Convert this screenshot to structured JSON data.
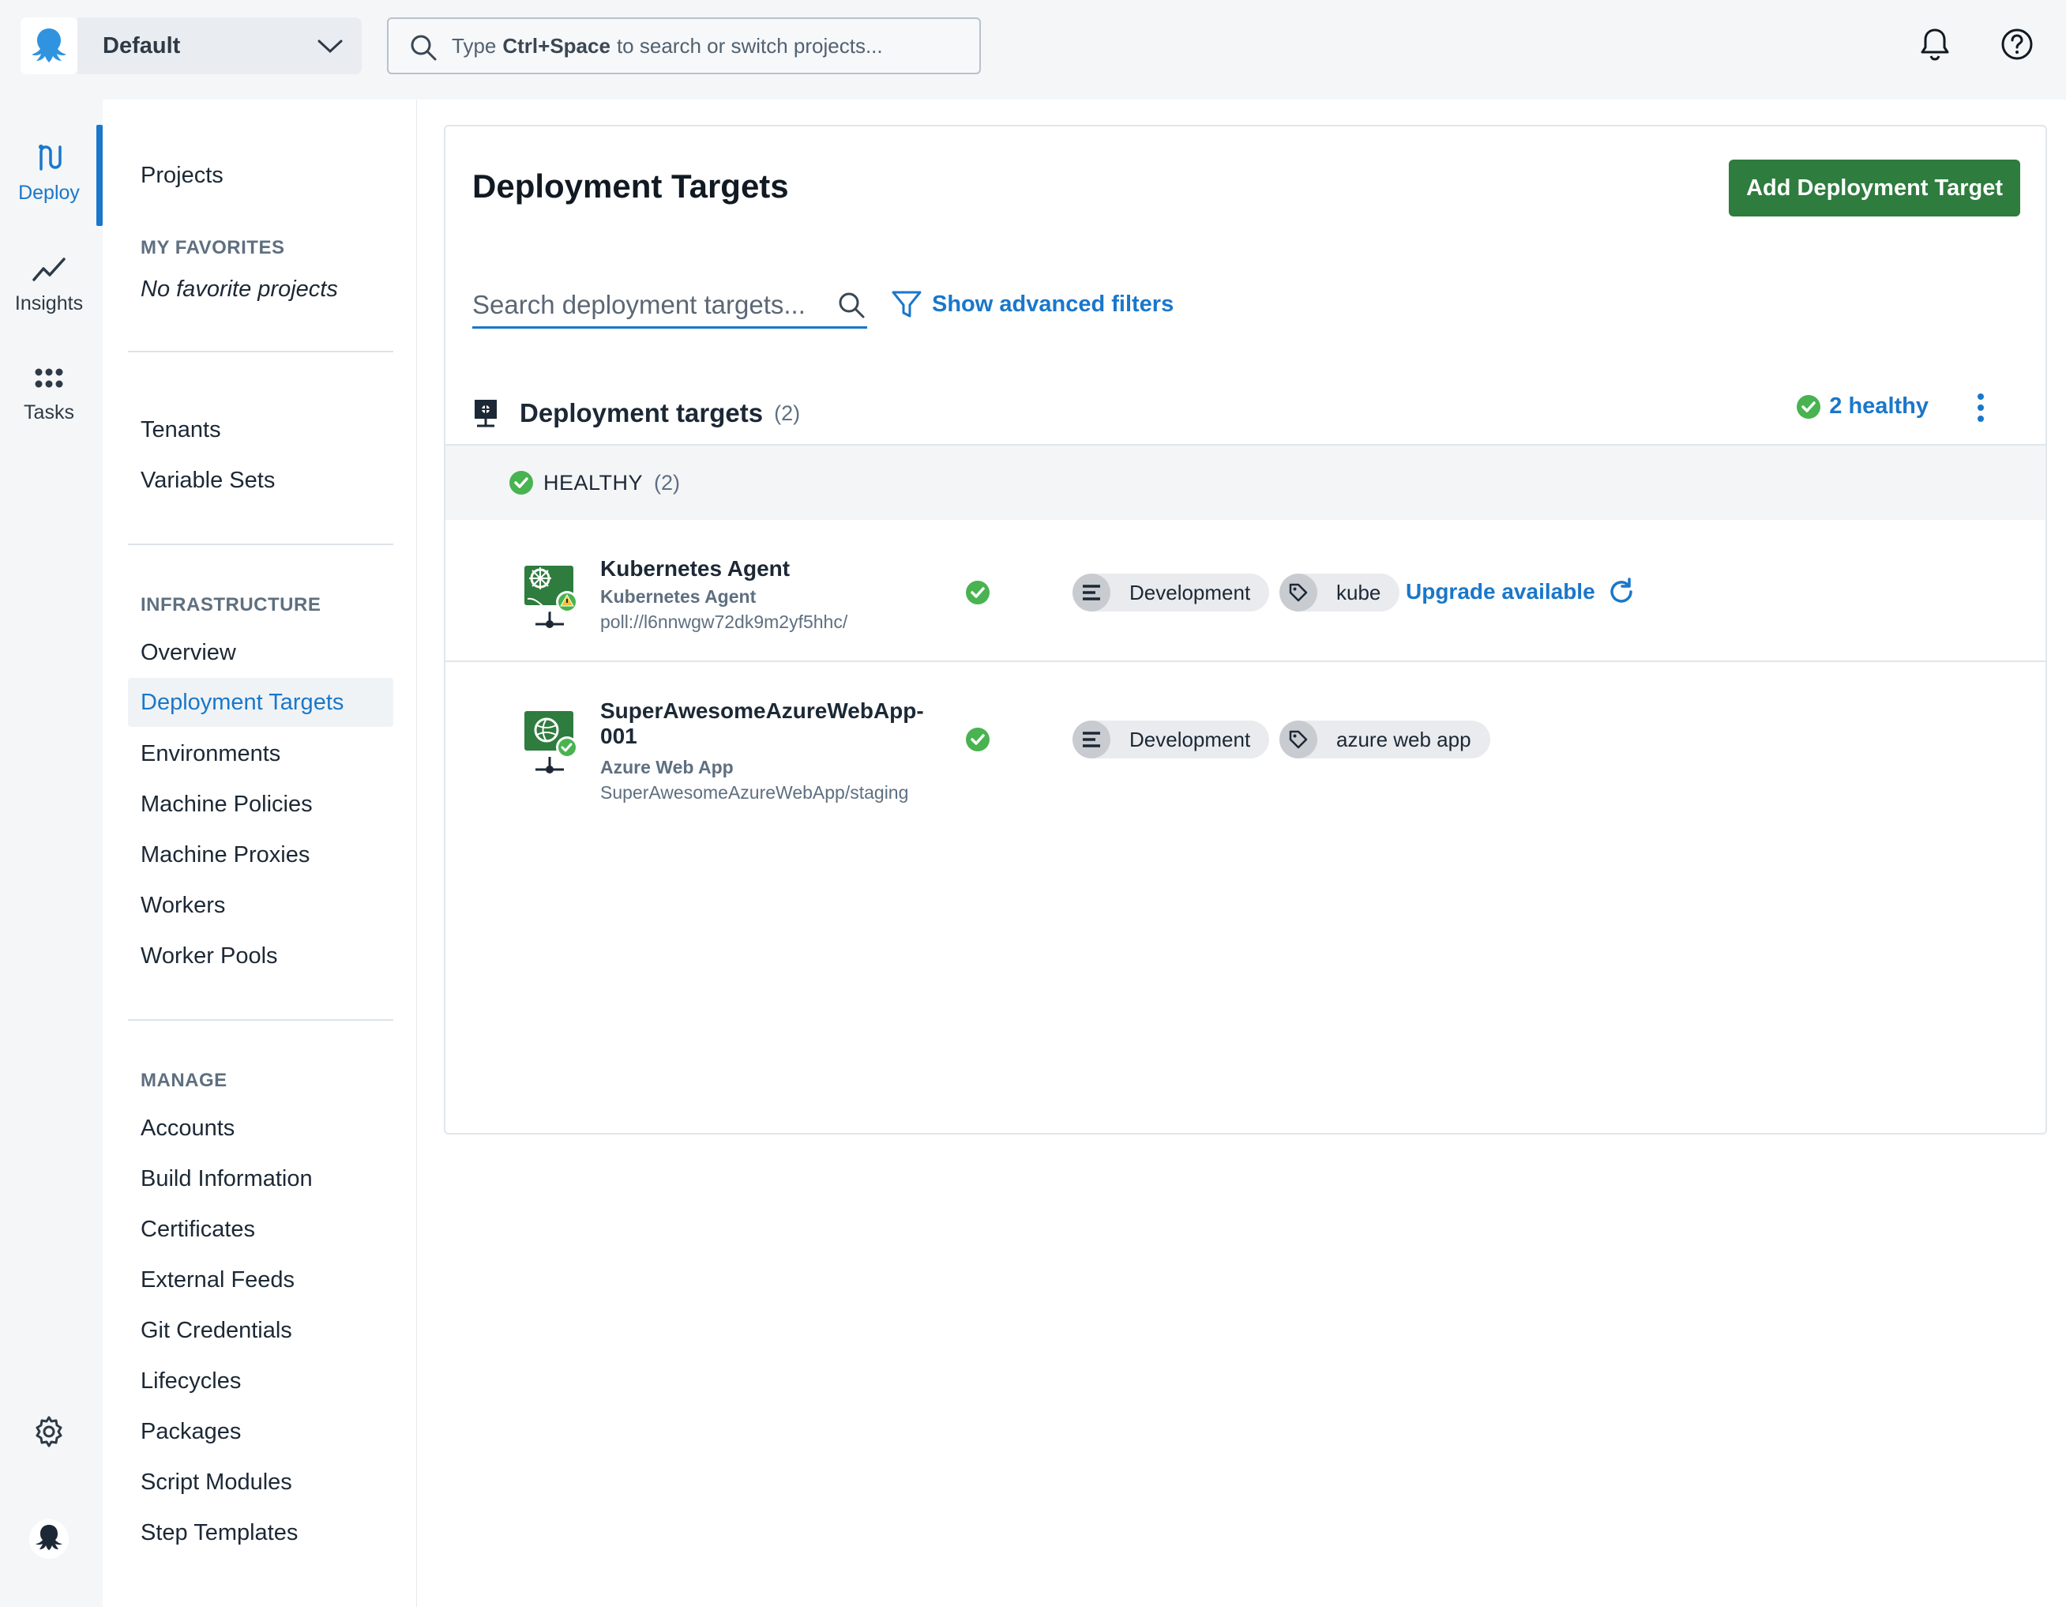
{
  "colors": {
    "accent": "#1a77ca",
    "primary_button": "#2e7c3e",
    "healthy": "#48b350"
  },
  "topbar": {
    "space_name": "Default",
    "search": {
      "prefix": "Type",
      "shortcut": "Ctrl+Space",
      "suffix": "to search or switch projects..."
    }
  },
  "rail": {
    "items": [
      {
        "label": "Deploy",
        "icon": "deploy-icon"
      },
      {
        "label": "Insights",
        "icon": "insights-icon"
      },
      {
        "label": "Tasks",
        "icon": "tasks-icon"
      }
    ]
  },
  "sidenav": {
    "projects": "Projects",
    "favorites_heading": "MY FAVORITES",
    "favorites_empty": "No favorite projects",
    "tenants": "Tenants",
    "variable_sets": "Variable Sets",
    "infrastructure_heading": "INFRASTRUCTURE",
    "infrastructure": [
      "Overview",
      "Deployment Targets",
      "Environments",
      "Machine Policies",
      "Machine Proxies",
      "Workers",
      "Worker Pools"
    ],
    "manage_heading": "MANAGE",
    "manage": [
      "Accounts",
      "Build Information",
      "Certificates",
      "External Feeds",
      "Git Credentials",
      "Lifecycles",
      "Packages",
      "Script Modules",
      "Step Templates"
    ]
  },
  "main": {
    "title": "Deployment Targets",
    "add_button": "Add Deployment Target",
    "search_placeholder": "Search deployment targets...",
    "advanced_filters": "Show advanced filters",
    "group_title": "Deployment targets",
    "group_count": "(2)",
    "healthy_summary": "2 healthy",
    "health_label": "HEALTHY",
    "health_count": "(2)",
    "targets": [
      {
        "name": "Kubernetes Agent",
        "type": "Kubernetes Agent",
        "uri": "poll://l6nnwgw72dk9m2yf5hhc/",
        "environment": "Development",
        "tag": "kube",
        "upgrade": "Upgrade available"
      },
      {
        "name": "SuperAwesomeAzureWebApp-001",
        "type": "Azure Web App",
        "uri": "SuperAwesomeAzureWebApp/staging",
        "environment": "Development",
        "tag": "azure web app"
      }
    ]
  }
}
